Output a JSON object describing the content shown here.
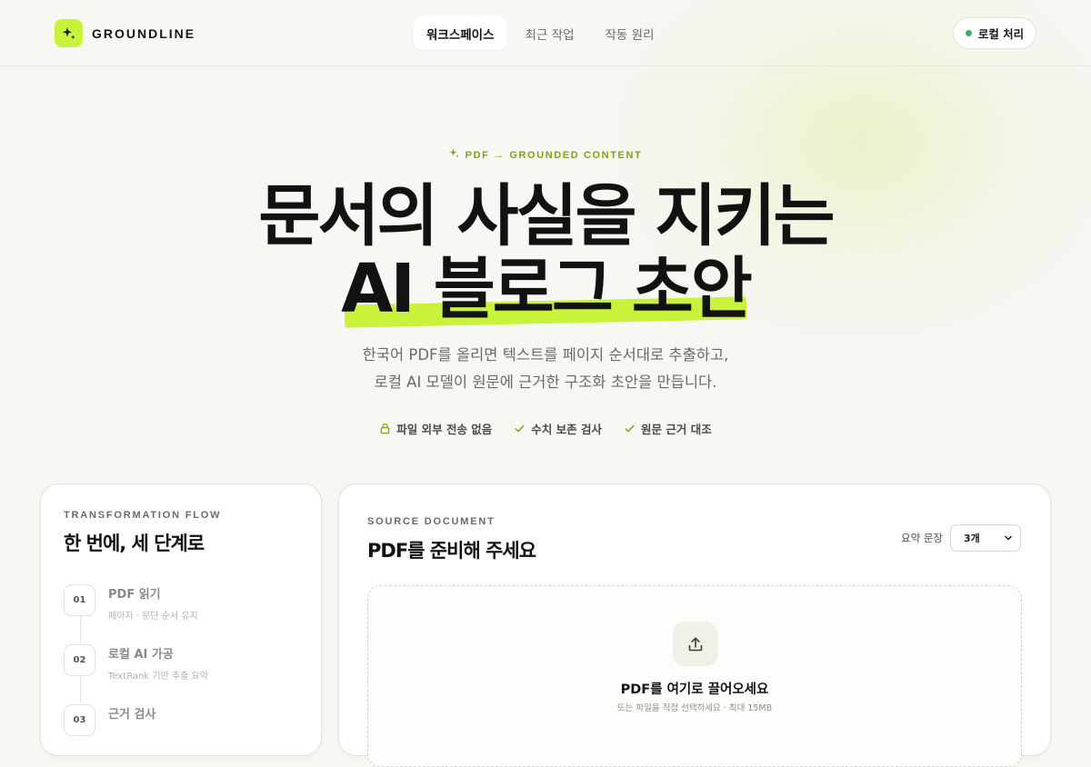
{
  "header": {
    "brand": "GROUNDLINE",
    "nav": [
      "워크스페이스",
      "최근 작업",
      "작동 원리"
    ],
    "status": "로컬 처리"
  },
  "hero": {
    "eyebrow": "PDF → GROUNDED CONTENT",
    "title_line1": "문서의 사실을 지키는",
    "title_line2": "AI 블로그 초안",
    "subtitle_line1": "한국어 PDF를 올리면 텍스트를 페이지 순서대로 추출하고,",
    "subtitle_line2": "로컬 AI 모델이 원문에 근거한 구조화 초안을 만듭니다.",
    "features": [
      "파일 외부 전송 없음",
      "수치 보존 검사",
      "원문 근거 대조"
    ]
  },
  "flow": {
    "label": "TRANSFORMATION FLOW",
    "title": "한 번에, 세 단계로",
    "steps": [
      {
        "num": "01",
        "title": "PDF 읽기",
        "desc": "페이지 · 문단 순서 유지"
      },
      {
        "num": "02",
        "title": "로컬 AI 가공",
        "desc": "TextRank 기반 추출 요약"
      },
      {
        "num": "03",
        "title": "근거 검사",
        "desc": ""
      }
    ]
  },
  "source": {
    "label": "SOURCE DOCUMENT",
    "title": "PDF를 준비해 주세요",
    "summary_label": "요약 문장",
    "summary_value": "3개",
    "drop_title": "PDF를 여기로 끌어오세요",
    "drop_sub": "또는 파일을 직접 선택하세요 · 최대 15MB"
  },
  "colors": {
    "accent": "#c9f23a",
    "accent_text": "#7ea318",
    "status": "#3bb25a",
    "background": "#f7f7f3"
  },
  "icons": {
    "logo": "sparkle-icon",
    "status": "status-dot",
    "lock": "lock-icon",
    "check": "check-icon",
    "upload": "upload-icon",
    "dropdown": "chevron-down-icon"
  }
}
